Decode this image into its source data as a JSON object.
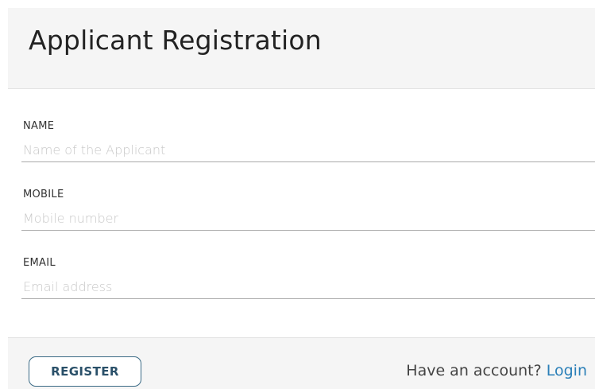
{
  "form": {
    "title": "Applicant Registration",
    "fields": [
      {
        "label": "NAME",
        "placeholder": "Name of the Applicant",
        "value": ""
      },
      {
        "label": "MOBILE",
        "placeholder": "Mobile number",
        "value": ""
      },
      {
        "label": "EMAIL",
        "placeholder": "Email address",
        "value": ""
      }
    ]
  },
  "footer": {
    "register_label": "REGISTER",
    "account_prompt": "Have an account?",
    "login_label": "Login"
  },
  "colors": {
    "header_background": "#f5f5f5",
    "button_border": "#3a6a85",
    "link": "#2a7fb8",
    "placeholder": "#c8c8c8"
  }
}
